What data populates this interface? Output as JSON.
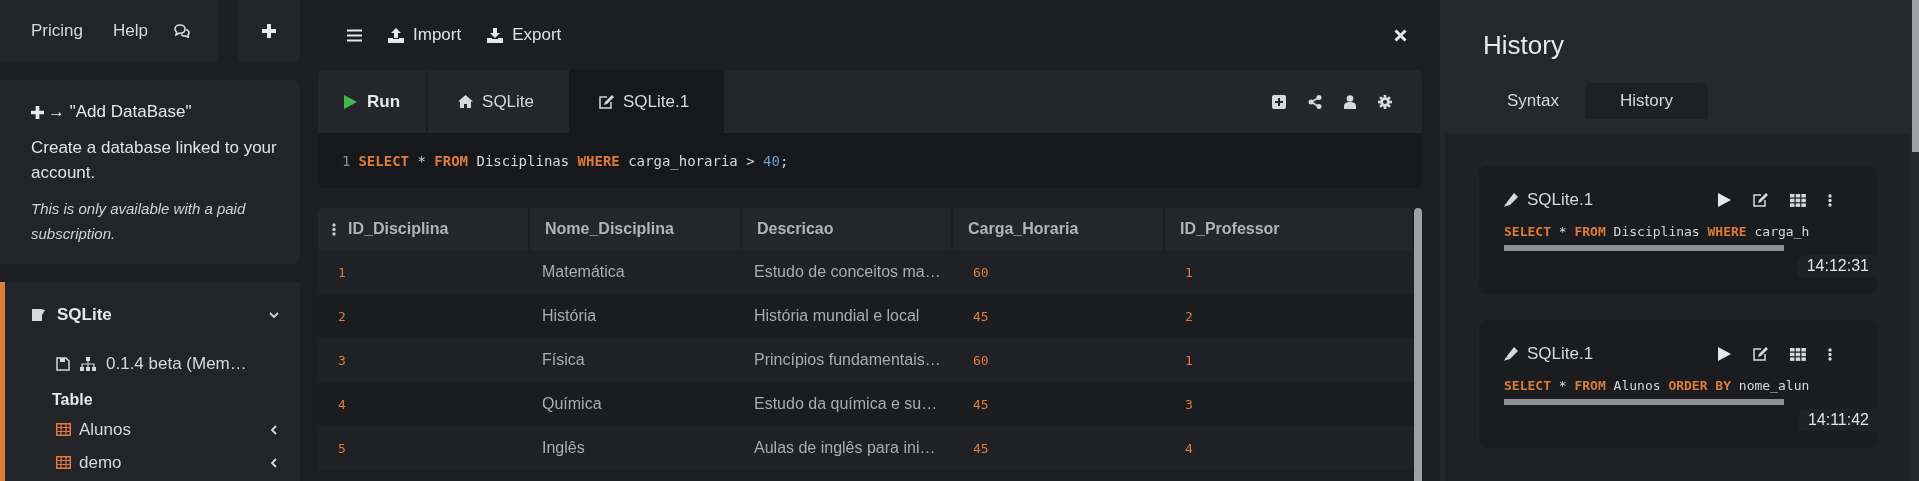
{
  "sidebar": {
    "nav_links": [
      "Pricing",
      "Help"
    ],
    "info": {
      "hint": "→ \"Add DataBase\"",
      "text": "Create a database linked to your account.",
      "note": "This is only available with a paid subscription."
    },
    "databases": [
      {
        "name": "SQLite",
        "expanded": true,
        "version": "0.1.4 beta (Mem…",
        "section": "Table",
        "tables": [
          {
            "name": "Alunos",
            "expanded": false
          },
          {
            "name": "demo",
            "expanded": false
          }
        ]
      }
    ]
  },
  "toolbar": {
    "buttons": [
      {
        "label": "Import",
        "kind": "import"
      },
      {
        "label": "Export",
        "kind": "export"
      }
    ]
  },
  "editor": {
    "run_label": "Run",
    "tabs": [
      {
        "label": "SQLite",
        "kind": "home",
        "selected": false
      },
      {
        "label": "SQLite.1",
        "kind": "edit",
        "selected": true
      }
    ],
    "lines": [
      {
        "number": "1",
        "tokens": [
          {
            "text": "SELECT",
            "kind": "keyword"
          },
          {
            "text": " * ",
            "kind": "plain"
          },
          {
            "text": "FROM",
            "kind": "keyword"
          },
          {
            "text": " Disciplinas ",
            "kind": "plain"
          },
          {
            "text": "WHERE",
            "kind": "keyword"
          },
          {
            "text": " carga_horaria > ",
            "kind": "plain"
          },
          {
            "text": "40",
            "kind": "number"
          },
          {
            "text": ";",
            "kind": "plain"
          }
        ]
      }
    ]
  },
  "results": {
    "columns": [
      {
        "label": "ID_Disciplina",
        "kind": "number"
      },
      {
        "label": "Nome_Disciplina",
        "kind": "text"
      },
      {
        "label": "Descricao",
        "kind": "text"
      },
      {
        "label": "Carga_Horaria",
        "kind": "number"
      },
      {
        "label": "ID_Professor",
        "kind": "number"
      }
    ],
    "rows": [
      [
        "1",
        "Matemática",
        "Estudo de conceitos ma…",
        "60",
        "1"
      ],
      [
        "2",
        "História",
        "História mundial e local",
        "45",
        "2"
      ],
      [
        "3",
        "Física",
        "Princípios fundamentais…",
        "60",
        "1"
      ],
      [
        "4",
        "Química",
        "Estudo da química e su…",
        "45",
        "3"
      ],
      [
        "5",
        "Inglês",
        "Aulas de inglês para ini…",
        "45",
        "4"
      ]
    ]
  },
  "panel": {
    "title": "History",
    "tabs": [
      {
        "label": "Syntax",
        "selected": false
      },
      {
        "label": "History",
        "selected": true
      }
    ],
    "entries": [
      {
        "name": "SQLite.1",
        "time": "14:12:31",
        "tokens": [
          {
            "text": "SELECT",
            "kind": "keyword"
          },
          {
            "text": " * ",
            "kind": "plain"
          },
          {
            "text": "FROM",
            "kind": "keyword"
          },
          {
            "text": " Disciplinas ",
            "kind": "plain"
          },
          {
            "text": "WHERE",
            "kind": "keyword"
          },
          {
            "text": " carga_h",
            "kind": "plain"
          }
        ]
      },
      {
        "name": "SQLite.1",
        "time": "14:11:42",
        "tokens": [
          {
            "text": "SELECT",
            "kind": "keyword"
          },
          {
            "text": " * ",
            "kind": "plain"
          },
          {
            "text": "FROM",
            "kind": "keyword"
          },
          {
            "text": " Alunos ",
            "kind": "plain"
          },
          {
            "text": "ORDER BY",
            "kind": "keyword"
          },
          {
            "text": " nome_alun",
            "kind": "plain"
          }
        ]
      }
    ]
  }
}
